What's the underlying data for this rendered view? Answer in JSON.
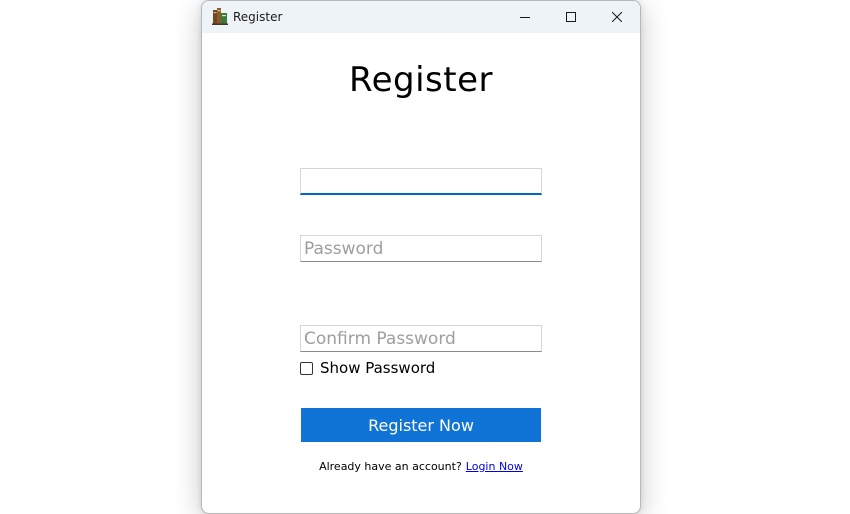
{
  "window": {
    "title": "Register",
    "app_icon": "books-icon",
    "controls": {
      "minimize": "minimize-icon",
      "maximize": "maximize-icon",
      "close": "close-icon"
    }
  },
  "form": {
    "heading": "Register",
    "username": {
      "value": "",
      "placeholder": ""
    },
    "password": {
      "value": "",
      "placeholder": "Password"
    },
    "confirm_password": {
      "value": "",
      "placeholder": "Confirm Password"
    },
    "show_password": {
      "label": "Show Password",
      "checked": false
    },
    "submit_label": "Register Now",
    "footer": {
      "text": "Already have an account?",
      "link_label": "Login Now"
    }
  },
  "colors": {
    "accent": "#0067c0",
    "button": "#0f74d6",
    "link": "#0000ee",
    "titlebar": "#eef3f7"
  }
}
